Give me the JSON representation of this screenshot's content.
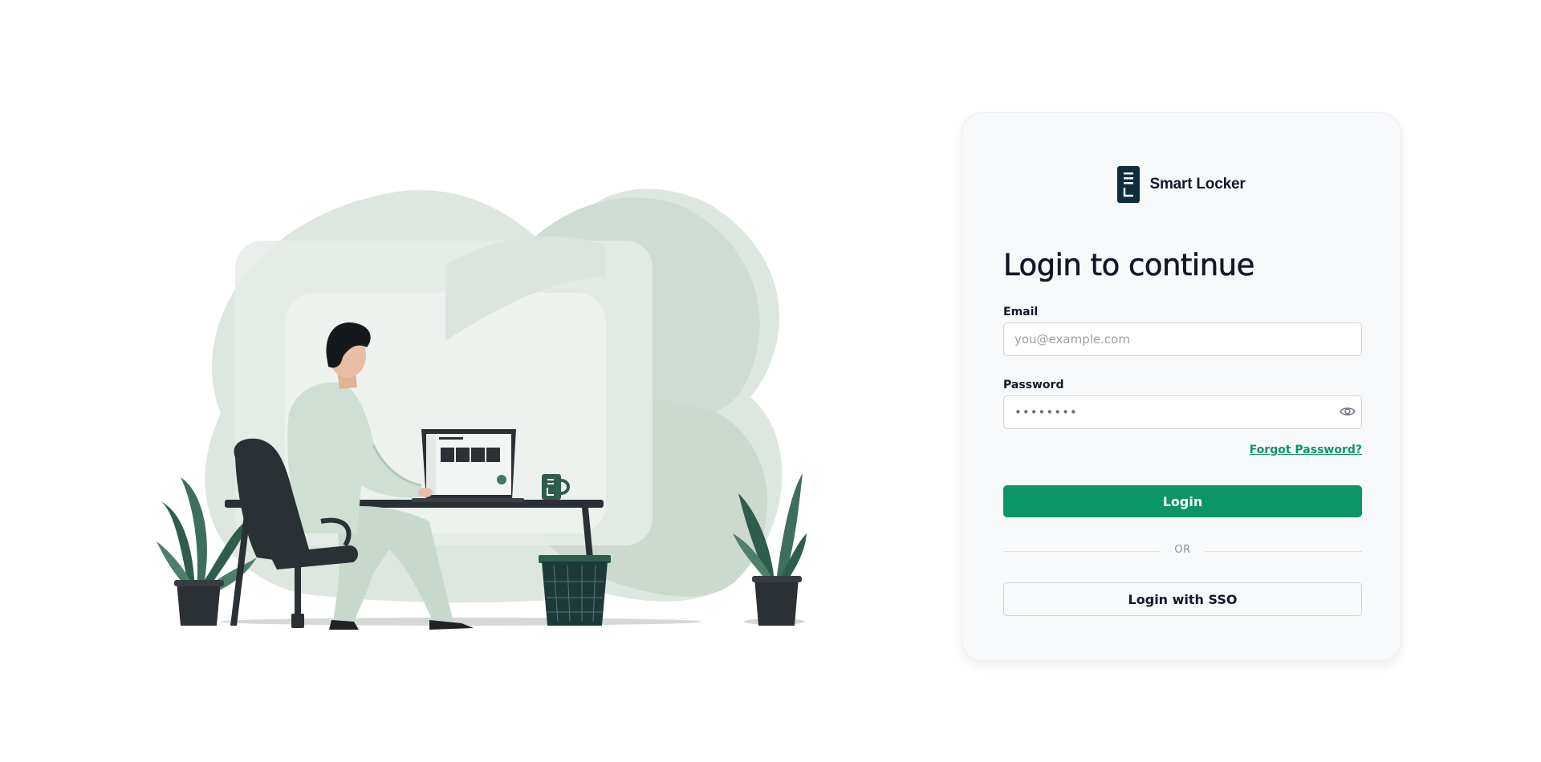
{
  "brand": {
    "name": "Smart Locker",
    "icon": "locker-logo-icon",
    "color": "#0f2d3d"
  },
  "login": {
    "title": "Login to continue",
    "email_label": "Email",
    "email_placeholder": "you@example.com",
    "password_label": "Password",
    "password_value": "••••••••",
    "show_password_icon": "eye-icon",
    "forgot_label": "Forgot Password?",
    "submit_label": "Login",
    "divider_text": "OR",
    "sso_label": "Login with SSO"
  },
  "colors": {
    "primary": "#0c9567",
    "link": "#0f9467",
    "card_bg": "#f8f9fa"
  },
  "illustration": {
    "description_icon": "person-at-desk-illustration"
  }
}
